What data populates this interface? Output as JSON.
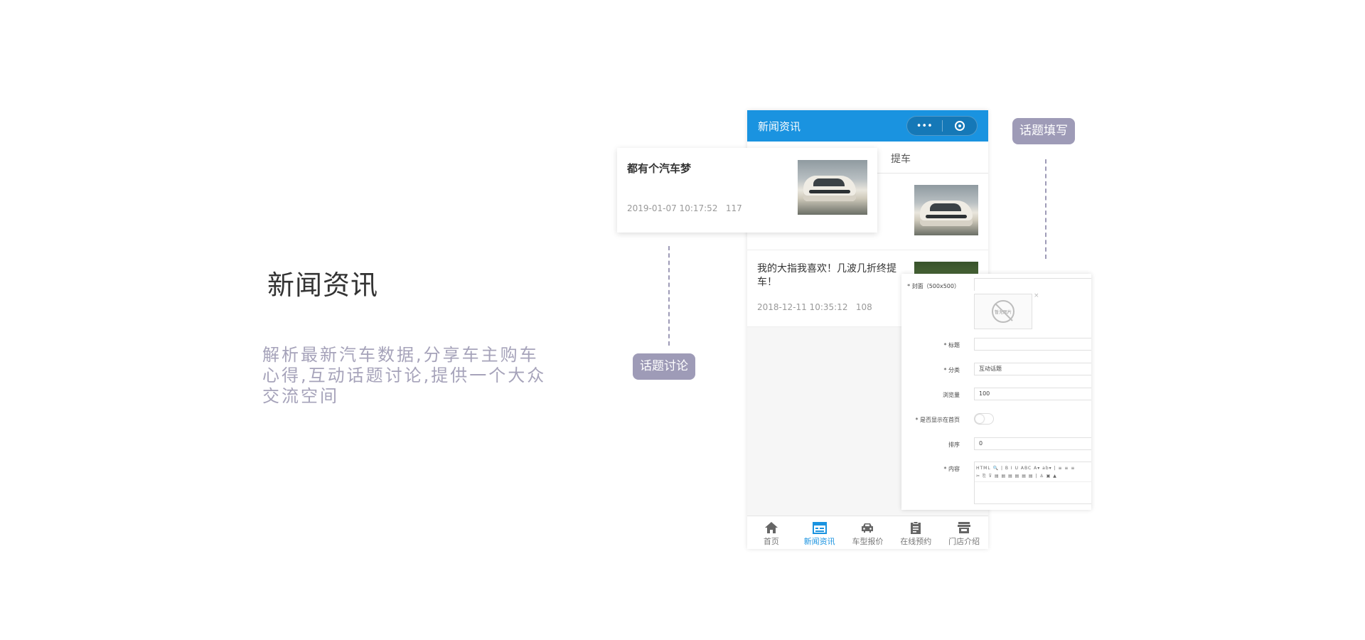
{
  "hero": {
    "title": "新闻资讯",
    "description": "解析最新汽车数据,分享车主购车心得,互动话题讨论,提供一个大众交流空间"
  },
  "phone": {
    "header_title": "新闻资讯",
    "capsule_menu": "•••",
    "tab_visible": "提车",
    "news": [
      {
        "title": "都有个汽车梦",
        "date": "2019-01-07 10:17:52",
        "views": "117"
      },
      {
        "title": "我的大指我喜欢！几波几折终提车！",
        "date": "2018-12-11 10:35:12",
        "views": "108"
      }
    ],
    "tabbar": [
      {
        "label": "首页",
        "icon": "home-icon"
      },
      {
        "label": "新闻资讯",
        "icon": "calendar-icon",
        "active": true
      },
      {
        "label": "车型报价",
        "icon": "car-icon"
      },
      {
        "label": "在线预约",
        "icon": "clipboard-icon"
      },
      {
        "label": "门店介绍",
        "icon": "store-icon"
      }
    ]
  },
  "form": {
    "cover_label": "* 封面（500x500）",
    "no_image_text": "暂无图片",
    "remove_mark": "×",
    "title_label": "* 标题",
    "title_value": "",
    "category_label": "* 分类",
    "category_value": "互动话题",
    "views_label": "浏览量",
    "views_value": "100",
    "show_home_label": "* 是否显示在首页",
    "sort_label": "排序",
    "sort_value": "0",
    "content_label": "* 内容",
    "toolbar_row1": "HTML 🔍 | B I U ABC A▾ ab▾ | ≡ ≡ ≡",
    "toolbar_row2": "✂ ⎘ ⊽ ▤ ▤ ▤ ▤ ▤ ▤ | ⚓ ▣ ▲"
  },
  "labels": {
    "topic_discussion": "话题讨论",
    "topic_fill": "话题填写"
  },
  "colors": {
    "brand_blue": "#1a93e0",
    "pill_purple": "#9e9bb7",
    "desc_text": "#a6a3ba"
  }
}
